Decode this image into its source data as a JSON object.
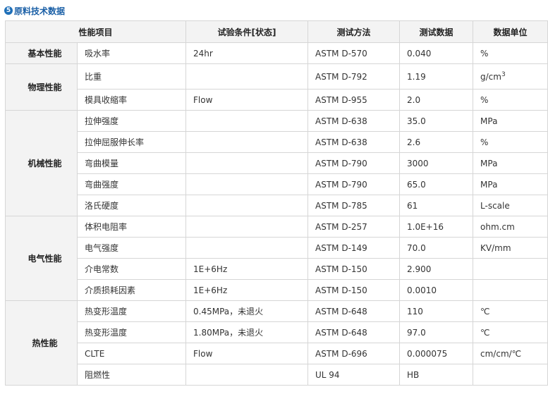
{
  "section_title": "原料技术数据",
  "header_icon_glyph": "5",
  "columns": [
    "性能项目",
    "试验条件[状态]",
    "测试方法",
    "测试数据",
    "数据单位"
  ],
  "groups": [
    {
      "name": "基本性能",
      "rows": [
        {
          "property": "吸水率",
          "condition": "24hr",
          "method": "ASTM D-570",
          "value": "0.040",
          "unit": "%"
        }
      ]
    },
    {
      "name": "物理性能",
      "rows": [
        {
          "property": "比重",
          "condition": "",
          "method": "ASTM D-792",
          "value": "1.19",
          "unit": "g/cm",
          "unit_sup": "3"
        },
        {
          "property": "模具收缩率",
          "condition": "Flow",
          "method": "ASTM D-955",
          "value": "2.0",
          "unit": "%"
        }
      ]
    },
    {
      "name": "机械性能",
      "rows": [
        {
          "property": "拉伸强度",
          "condition": "",
          "method": "ASTM D-638",
          "value": "35.0",
          "unit": "MPa"
        },
        {
          "property": "拉伸屈服伸长率",
          "condition": "",
          "method": "ASTM D-638",
          "value": "2.6",
          "unit": "%"
        },
        {
          "property": "弯曲模量",
          "condition": "",
          "method": "ASTM D-790",
          "value": "3000",
          "unit": "MPa"
        },
        {
          "property": "弯曲强度",
          "condition": "",
          "method": "ASTM D-790",
          "value": "65.0",
          "unit": "MPa"
        },
        {
          "property": "洛氏硬度",
          "condition": "",
          "method": "ASTM D-785",
          "value": "61",
          "unit": "L-scale"
        }
      ]
    },
    {
      "name": "电气性能",
      "rows": [
        {
          "property": "体积电阻率",
          "condition": "",
          "method": "ASTM D-257",
          "value": "1.0E+16",
          "unit": "ohm.cm"
        },
        {
          "property": "电气强度",
          "condition": "",
          "method": "ASTM D-149",
          "value": "70.0",
          "unit": "KV/mm"
        },
        {
          "property": "介电常数",
          "condition": "1E+6Hz",
          "method": "ASTM D-150",
          "value": "2.900",
          "unit": ""
        },
        {
          "property": "介质损耗因素",
          "condition": "1E+6Hz",
          "method": "ASTM D-150",
          "value": "0.0010",
          "unit": ""
        }
      ]
    },
    {
      "name": "热性能",
      "rows": [
        {
          "property": "热变形温度",
          "condition": "0.45MPa，未退火",
          "method": "ASTM D-648",
          "value": "110",
          "unit": "℃"
        },
        {
          "property": "热变形温度",
          "condition": "1.80MPa，未退火",
          "method": "ASTM D-648",
          "value": "97.0",
          "unit": "℃"
        },
        {
          "property": "CLTE",
          "condition": "Flow",
          "method": "ASTM D-696",
          "value": "0.000075",
          "unit": "cm/cm/℃"
        },
        {
          "property": "阻燃性",
          "condition": "",
          "method": "UL 94",
          "value": "HB",
          "unit": ""
        }
      ]
    }
  ]
}
